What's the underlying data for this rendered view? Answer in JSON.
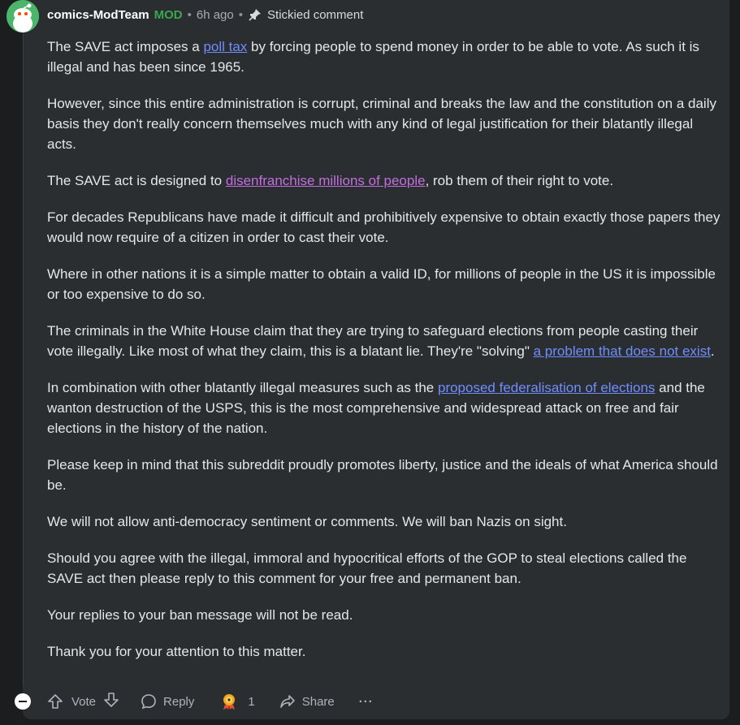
{
  "comment": {
    "author": "comics-ModTeam",
    "flair": "MOD",
    "separator": "•",
    "age": "6h ago",
    "stickied_label": "Stickied comment",
    "paragraphs": [
      [
        {
          "text": "The SAVE act imposes a "
        },
        {
          "text": "poll tax",
          "link": true
        },
        {
          "text": " by forcing people to spend money in order to be able to vote. As such it is illegal and has been since 1965."
        }
      ],
      [
        {
          "text": "However, since this entire administration is corrupt, criminal and breaks the law and the constitution on a daily basis they don't really concern themselves much with any kind of legal justification for their blatantly illegal acts."
        }
      ],
      [
        {
          "text": "The SAVE act is designed to "
        },
        {
          "text": "disenfranchise millions of people",
          "link": true,
          "visited": true
        },
        {
          "text": ", rob them of their right to vote."
        }
      ],
      [
        {
          "text": "For decades Republicans have made it difficult and prohibitively expensive to obtain exactly those papers they would now require of a citizen in order to cast their vote."
        }
      ],
      [
        {
          "text": "Where in other nations it is a simple matter to obtain a valid ID, for millions of people in the US it is impossible or too expensive to do so."
        }
      ],
      [
        {
          "text": "The criminals in the White House claim that they are trying to safeguard elections from people casting their vote illegally. Like most of what they claim, this is a blatant lie. They're \"solving\" "
        },
        {
          "text": "a problem that does not exist",
          "link": true
        },
        {
          "text": "."
        }
      ],
      [
        {
          "text": "In combination with other blatantly illegal measures such as the "
        },
        {
          "text": "proposed federalisation of elections",
          "link": true
        },
        {
          "text": " and the wanton destruction of the USPS, this is the most comprehensive and widespread attack on free and fair elections in the history of the nation."
        }
      ],
      [
        {
          "text": "Please keep in mind that this subreddit proudly promotes liberty, justice and the ideals of what America should be."
        }
      ],
      [
        {
          "text": "We will not allow anti-democracy sentiment or comments. We will ban Nazis on sight."
        }
      ],
      [
        {
          "text": "Should you agree with the illegal, immoral and hypocritical efforts of the GOP to steal elections called the SAVE act then please reply to this comment for your free and permanent ban."
        }
      ],
      [
        {
          "text": "Your replies to your ban message will not be read."
        }
      ],
      [
        {
          "text": "Thank you for your attention to this matter."
        }
      ]
    ]
  },
  "actions": {
    "vote_label": "Vote",
    "reply_label": "Reply",
    "award_count": "1",
    "share_label": "Share",
    "more_label": "···"
  },
  "icons": {
    "avatar": "snoo-avatar-icon",
    "pin": "pin-icon",
    "collapse": "collapse-icon",
    "upvote": "upvote-arrow-icon",
    "downvote": "downvote-arrow-icon",
    "reply": "speech-bubble-icon",
    "award": "award-icon",
    "share": "share-arrow-icon",
    "more": "ellipsis-icon"
  },
  "colors": {
    "page_bg": "#1b1d1f",
    "card_bg": "#2b2e31",
    "link": "#6f8dff",
    "visited_link": "#c36de0",
    "mod_flair": "#3aa650",
    "avatar_bg": "#4cb56c"
  }
}
